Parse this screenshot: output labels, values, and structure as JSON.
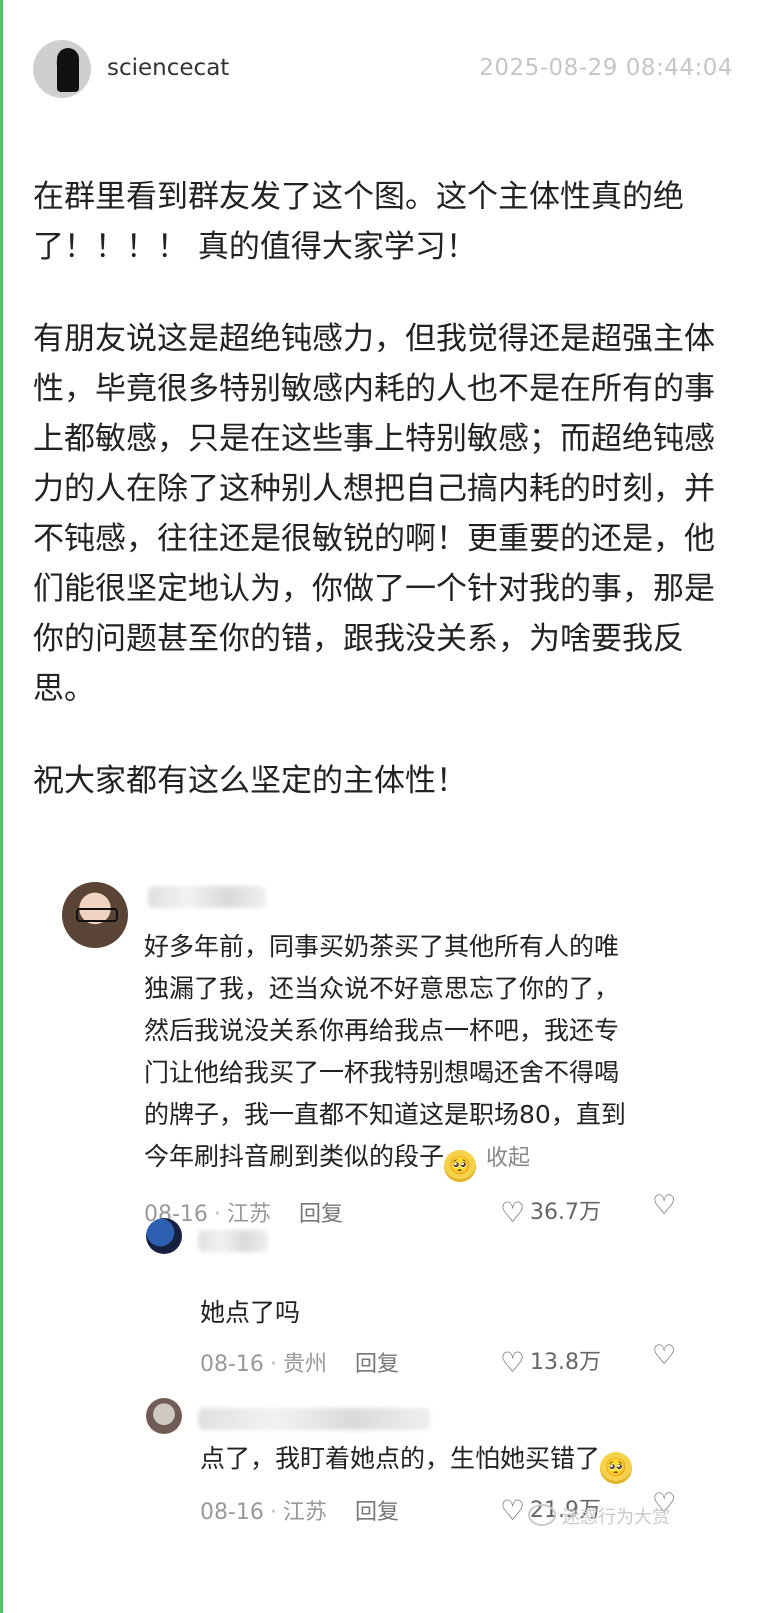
{
  "post": {
    "username": "sciencecat",
    "timestamp": "2025-08-29 08:44:04",
    "paragraphs": [
      "在群里看到群友发了这个图。这个主体性真的绝了！！！！ 真的值得大家学习！",
      "有朋友说这是超绝钝感力，但我觉得还是超强主体性，毕竟很多特别敏感内耗的人也不是在所有的事上都敏感，只是在这些事上特别敏感；而超绝钝感力的人在除了这种别人想把自己搞内耗的时刻，并不钝感，往往还是很敏锐的啊！更重要的还是，他们能很坚定地认为，你做了一个针对我的事，那是你的问题甚至你的错，跟我没关系，为啥要我反思。",
      "祝大家都有这么坚定的主体性！"
    ]
  },
  "comments": [
    {
      "text_lines": [
        "好多年前，同事买奶茶买了其他所有人的唯",
        "独漏了我，还当众说不好意思忘了你的了，",
        "然后我说没关系你再给我点一杯吧，我还专",
        "门让他给我买了一杯我特别想喝还舍不得喝",
        "的牌子，我一直都不知道这是职场80，直到"
      ],
      "last_line": "今年刷抖音刷到类似的段子",
      "collapse": "收起",
      "date": "08-16",
      "location": "江苏",
      "reply": "回复",
      "likes": "36.7万"
    },
    {
      "text": "她点了吗",
      "date": "08-16",
      "location": "贵州",
      "reply": "回复",
      "likes": "13.8万"
    },
    {
      "text": "点了，我盯着她点的，生怕她买错了",
      "date": "08-16",
      "location": "江苏",
      "reply": "回复",
      "likes": "21.9万"
    }
  ],
  "watermark": "迷惑行为大赏",
  "icons": {
    "like": "heart-outline-icon",
    "dislike": "broken-heart-icon",
    "emoji": "pleading-face-emoji-icon"
  }
}
